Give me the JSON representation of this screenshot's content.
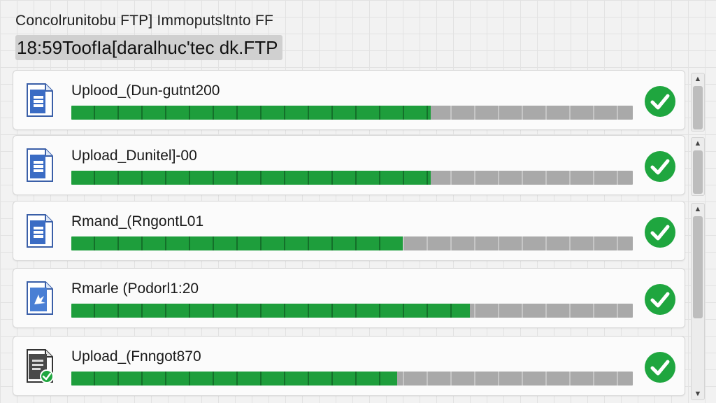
{
  "app": {
    "title": "Concolrunitobu FTP] Immoputsltnto FF",
    "status_line": "18:59ToofIa[daralhuc'tec dk.FTP"
  },
  "transfers": [
    {
      "name": "Uplood_(Dun-gutnt200",
      "progress": 0.64,
      "status": "complete",
      "icon": "spreadsheet-file-icon"
    },
    {
      "name": "Upload_Dunitel]-00",
      "progress": 0.64,
      "status": "complete",
      "icon": "spreadsheet-file-icon"
    },
    {
      "name": "Rmand_(RngontL01",
      "progress": 0.59,
      "status": "complete",
      "icon": "spreadsheet-file-icon"
    },
    {
      "name": "Rmarle (Podorl1:20",
      "progress": 0.71,
      "status": "complete",
      "icon": "document-file-icon"
    },
    {
      "name": "Upload_(Fnngot870",
      "progress": 0.58,
      "status": "complete",
      "icon": "verified-document-icon"
    }
  ],
  "colors": {
    "progress_fill": "#1e9e3c",
    "progress_track": "#a9a9a9",
    "check_badge": "#1fa63f"
  }
}
